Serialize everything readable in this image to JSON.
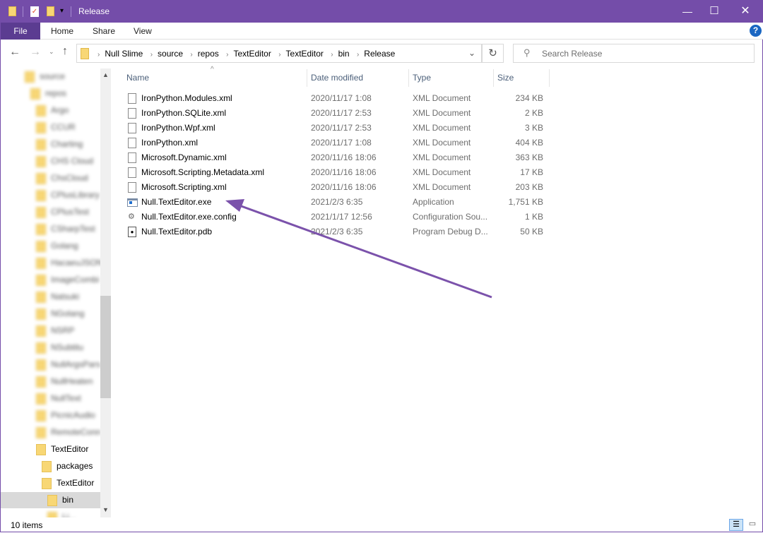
{
  "window": {
    "title": "Release",
    "accent": "#744DA9"
  },
  "ribbon": {
    "tabs": [
      "File",
      "Home",
      "Share",
      "View"
    ]
  },
  "address": {
    "breadcrumb": [
      "Null Slime",
      "source",
      "repos",
      "TextEditor",
      "TextEditor",
      "bin",
      "Release"
    ]
  },
  "search": {
    "placeholder": "Search Release"
  },
  "nav": {
    "items": [
      {
        "label": "source",
        "level": 0,
        "blurred": true
      },
      {
        "label": "repos",
        "level": 1,
        "blurred": true
      },
      {
        "label": "Argo",
        "level": 2,
        "blurred": true
      },
      {
        "label": "CCUR",
        "level": 2,
        "blurred": true
      },
      {
        "label": "Charting",
        "level": 2,
        "blurred": true
      },
      {
        "label": "CHS Cloud",
        "level": 2,
        "blurred": true
      },
      {
        "label": "ChsCloud",
        "level": 2,
        "blurred": true
      },
      {
        "label": "CPlusLibrary",
        "level": 2,
        "blurred": true
      },
      {
        "label": "CPlusTest",
        "level": 2,
        "blurred": true
      },
      {
        "label": "CSharpTest",
        "level": 2,
        "blurred": true
      },
      {
        "label": "Golang",
        "level": 2,
        "blurred": true
      },
      {
        "label": "HacaeuJSON",
        "level": 2,
        "blurred": true
      },
      {
        "label": "ImageCombi",
        "level": 2,
        "blurred": true
      },
      {
        "label": "Natsuki",
        "level": 2,
        "blurred": true
      },
      {
        "label": "NGolang",
        "level": 2,
        "blurred": true
      },
      {
        "label": "NSRP",
        "level": 2,
        "blurred": true
      },
      {
        "label": "NSubtitu",
        "level": 2,
        "blurred": true
      },
      {
        "label": "NullArgsPars",
        "level": 2,
        "blurred": true
      },
      {
        "label": "NullHeaten",
        "level": 2,
        "blurred": true
      },
      {
        "label": "NullText",
        "level": 2,
        "blurred": true
      },
      {
        "label": "PicnicAudio",
        "level": 2,
        "blurred": true
      },
      {
        "label": "RemoteConn",
        "level": 2,
        "blurred": true
      },
      {
        "label": "TextEditor",
        "level": 2,
        "blurred": false
      },
      {
        "label": "packages",
        "level": 3,
        "blurred": false
      },
      {
        "label": "TextEditor",
        "level": 3,
        "blurred": false
      },
      {
        "label": "bin",
        "level": 4,
        "blurred": false,
        "selected": true
      },
      {
        "label": "Li...",
        "level": 4,
        "blurred": true
      }
    ]
  },
  "columns": {
    "name": "Name",
    "date": "Date modified",
    "type": "Type",
    "size": "Size"
  },
  "files": [
    {
      "name": "IronPython.Modules.xml",
      "date": "2020/11/17 1:08",
      "type": "XML Document",
      "size": "234 KB",
      "icon": "xml-file-icon"
    },
    {
      "name": "IronPython.SQLite.xml",
      "date": "2020/11/17 2:53",
      "type": "XML Document",
      "size": "2 KB",
      "icon": "xml-file-icon"
    },
    {
      "name": "IronPython.Wpf.xml",
      "date": "2020/11/17 2:53",
      "type": "XML Document",
      "size": "3 KB",
      "icon": "xml-file-icon"
    },
    {
      "name": "IronPython.xml",
      "date": "2020/11/17 1:08",
      "type": "XML Document",
      "size": "404 KB",
      "icon": "xml-file-icon"
    },
    {
      "name": "Microsoft.Dynamic.xml",
      "date": "2020/11/16 18:06",
      "type": "XML Document",
      "size": "363 KB",
      "icon": "xml-file-icon"
    },
    {
      "name": "Microsoft.Scripting.Metadata.xml",
      "date": "2020/11/16 18:06",
      "type": "XML Document",
      "size": "17 KB",
      "icon": "xml-file-icon"
    },
    {
      "name": "Microsoft.Scripting.xml",
      "date": "2020/11/16 18:06",
      "type": "XML Document",
      "size": "203 KB",
      "icon": "xml-file-icon"
    },
    {
      "name": "Null.TextEditor.exe",
      "date": "2021/2/3 6:35",
      "type": "Application",
      "size": "1,751 KB",
      "icon": "application-icon"
    },
    {
      "name": "Null.TextEditor.exe.config",
      "date": "2021/1/17 12:56",
      "type": "Configuration Sou...",
      "size": "1 KB",
      "icon": "config-file-icon"
    },
    {
      "name": "Null.TextEditor.pdb",
      "date": "2021/2/3 6:35",
      "type": "Program Debug D...",
      "size": "50 KB",
      "icon": "pdb-file-icon"
    }
  ],
  "status": {
    "count": "10 items"
  },
  "annotation": {
    "color": "#7B52AB"
  }
}
